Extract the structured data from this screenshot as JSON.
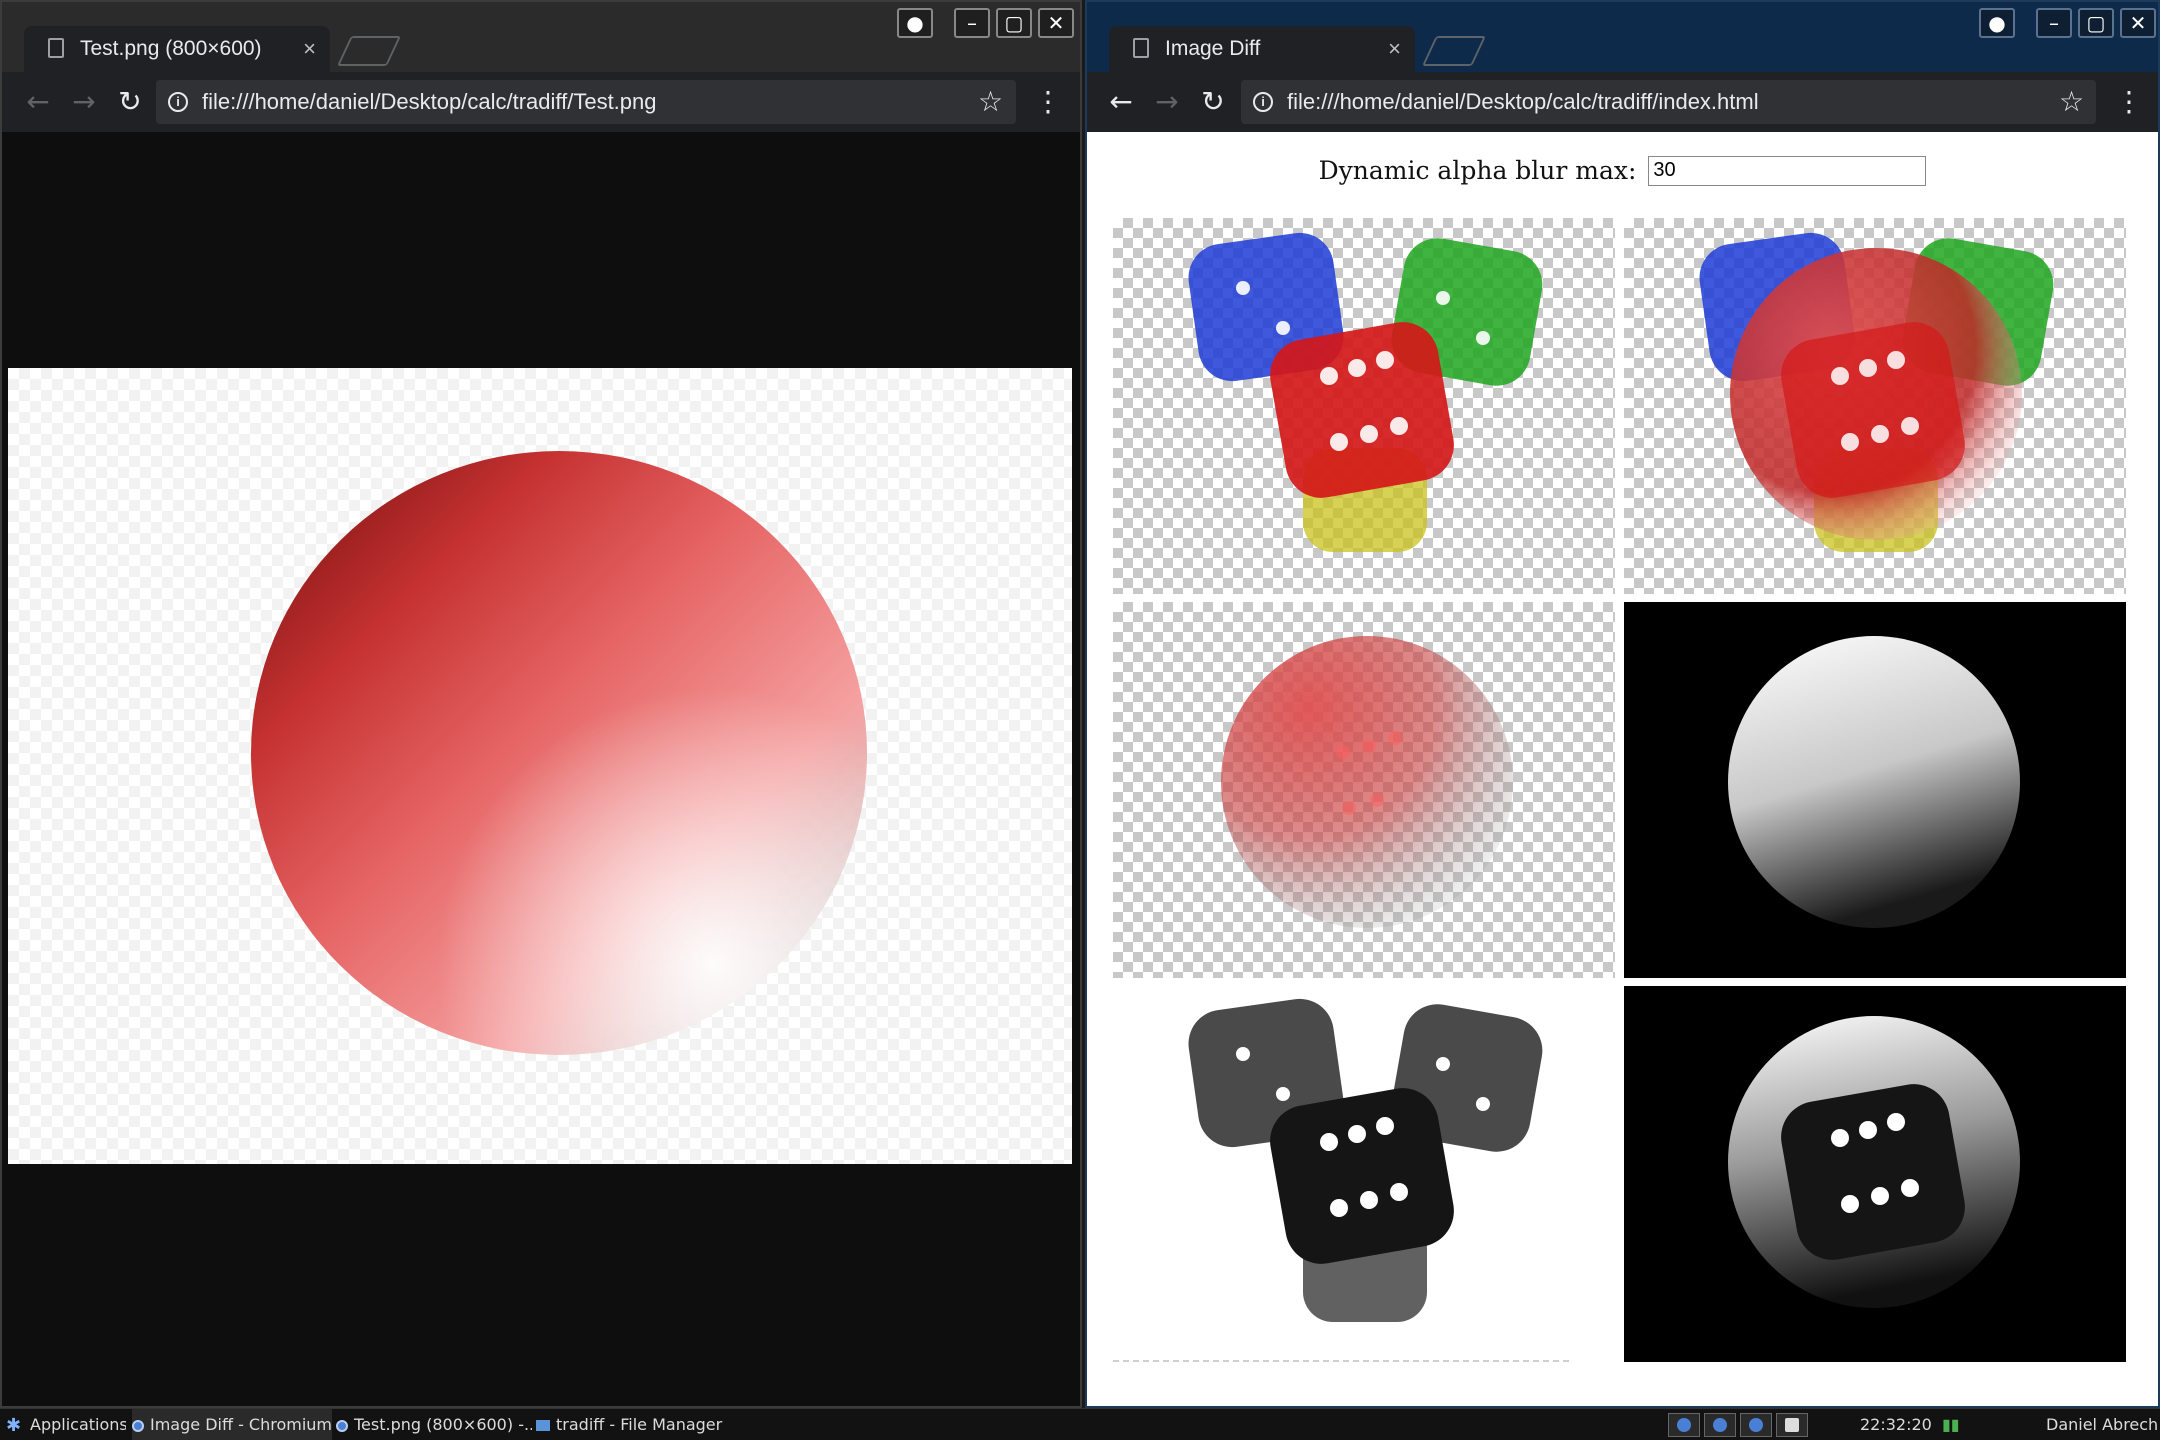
{
  "left_window": {
    "tab_title": "Test.png (800×600)",
    "url": "file:///home/daniel/Desktop/calc/tradiff/Test.png"
  },
  "right_window": {
    "tab_title": "Image Diff",
    "url": "file:///home/daniel/Desktop/calc/tradiff/index.html",
    "blur_label": "Dynamic alpha blur max:",
    "blur_value": "30"
  },
  "icons": {
    "close": "×",
    "back": "←",
    "forward": "→",
    "reload": "↻",
    "star": "☆",
    "menu": "⋮",
    "minimize": "–",
    "maximize": "▢",
    "window_close": "✕"
  },
  "colors": {
    "die_blue": "#1f3cd6",
    "die_green": "#1fa61f",
    "die_red": "#d41818",
    "die_yellow": "#c9c21c",
    "sphere_red": "#e05050"
  },
  "taskbar": {
    "apps_label": "Applications",
    "items": [
      {
        "label": "Image Diff - Chromium"
      },
      {
        "label": "Test.png (800×600) -..."
      },
      {
        "label": "tradiff - File Manager"
      }
    ],
    "clock": "22:32:20",
    "user": "Daniel Abrecht"
  }
}
